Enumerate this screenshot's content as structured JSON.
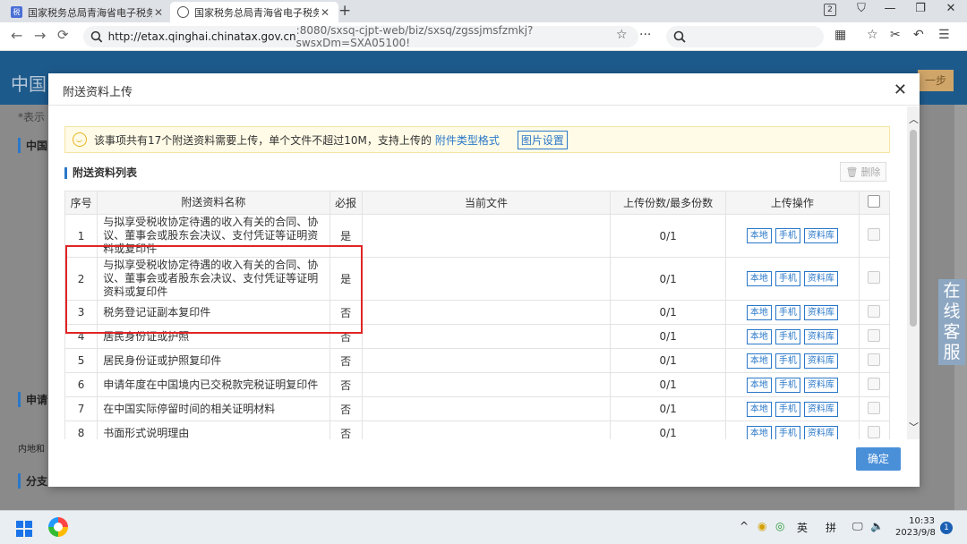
{
  "browser": {
    "tabs": [
      {
        "title": "国家税务总局青海省电子税务",
        "favicon": "tax-favicon",
        "active": false
      },
      {
        "title": "国家税务总局青海省电子税务",
        "favicon": "globe-icon",
        "active": true
      }
    ],
    "window_badge": "2",
    "url_host": "http://etax.qinghai.chinatax.gov.cn",
    "url_path": ":8080/sxsq-cjpt-web/biz/sxsq/zgssjmsfzmkj?swsxDm=SXA05100!",
    "more": "···"
  },
  "page": {
    "site_title": "中国",
    "next_label": "一步",
    "note_fragment": "*表示",
    "section_labels": [
      "中国",
      "申请",
      "分支"
    ],
    "row_fragment": "内地和",
    "online_service": "在线客服"
  },
  "modal": {
    "title": "附送资料上传",
    "notice_prefix": "该事项共有17个附送资料需要上传，单个文件不超过10M，支持上传的",
    "notice_link": "附件类型格式",
    "picture_settings": "图片设置",
    "list_title": "附送资料列表",
    "delete_label": "删除",
    "confirm_label": "确定",
    "columns": [
      "序号",
      "附送资料名称",
      "必报",
      "当前文件",
      "上传份数/最多份数",
      "上传操作"
    ],
    "upload_buttons": [
      "本地",
      "手机",
      "资料库"
    ],
    "rows": [
      {
        "no": "1",
        "name": "与拟享受税收协定待遇的收入有关的合同、协议、董事会或股东会决议、支付凭证等证明资料或复印件",
        "required": "是",
        "file": "",
        "count": "0/1"
      },
      {
        "no": "2",
        "name": "与拟享受税收协定待遇的收入有关的合同、协议、董事会或者股东会决议、支付凭证等证明资料或复印件",
        "required": "是",
        "file": "",
        "count": "0/1"
      },
      {
        "no": "3",
        "name": "税务登记证副本复印件",
        "required": "否",
        "file": "",
        "count": "0/1"
      },
      {
        "no": "4",
        "name": "居民身份证或护照",
        "required": "否",
        "file": "",
        "count": "0/1"
      },
      {
        "no": "5",
        "name": "居民身份证或护照复印件",
        "required": "否",
        "file": "",
        "count": "0/1"
      },
      {
        "no": "6",
        "name": "申请年度在中国境内已交税款完税证明复印件",
        "required": "否",
        "file": "",
        "count": "0/1"
      },
      {
        "no": "7",
        "name": "在中国实际停留时间的相关证明材料",
        "required": "否",
        "file": "",
        "count": "0/1"
      },
      {
        "no": "8",
        "name": "书面形式说明理由",
        "required": "否",
        "file": "",
        "count": "0/1"
      }
    ]
  },
  "taskbar": {
    "ime_lang": "英",
    "ime_mode": "拼",
    "time": "10:33",
    "date": "2023/9/8",
    "notifications": "1"
  },
  "colors": {
    "accent": "#2a78c9",
    "highlight": "#e02424",
    "header": "#1d5a8c",
    "confirm": "#4a90d9"
  }
}
